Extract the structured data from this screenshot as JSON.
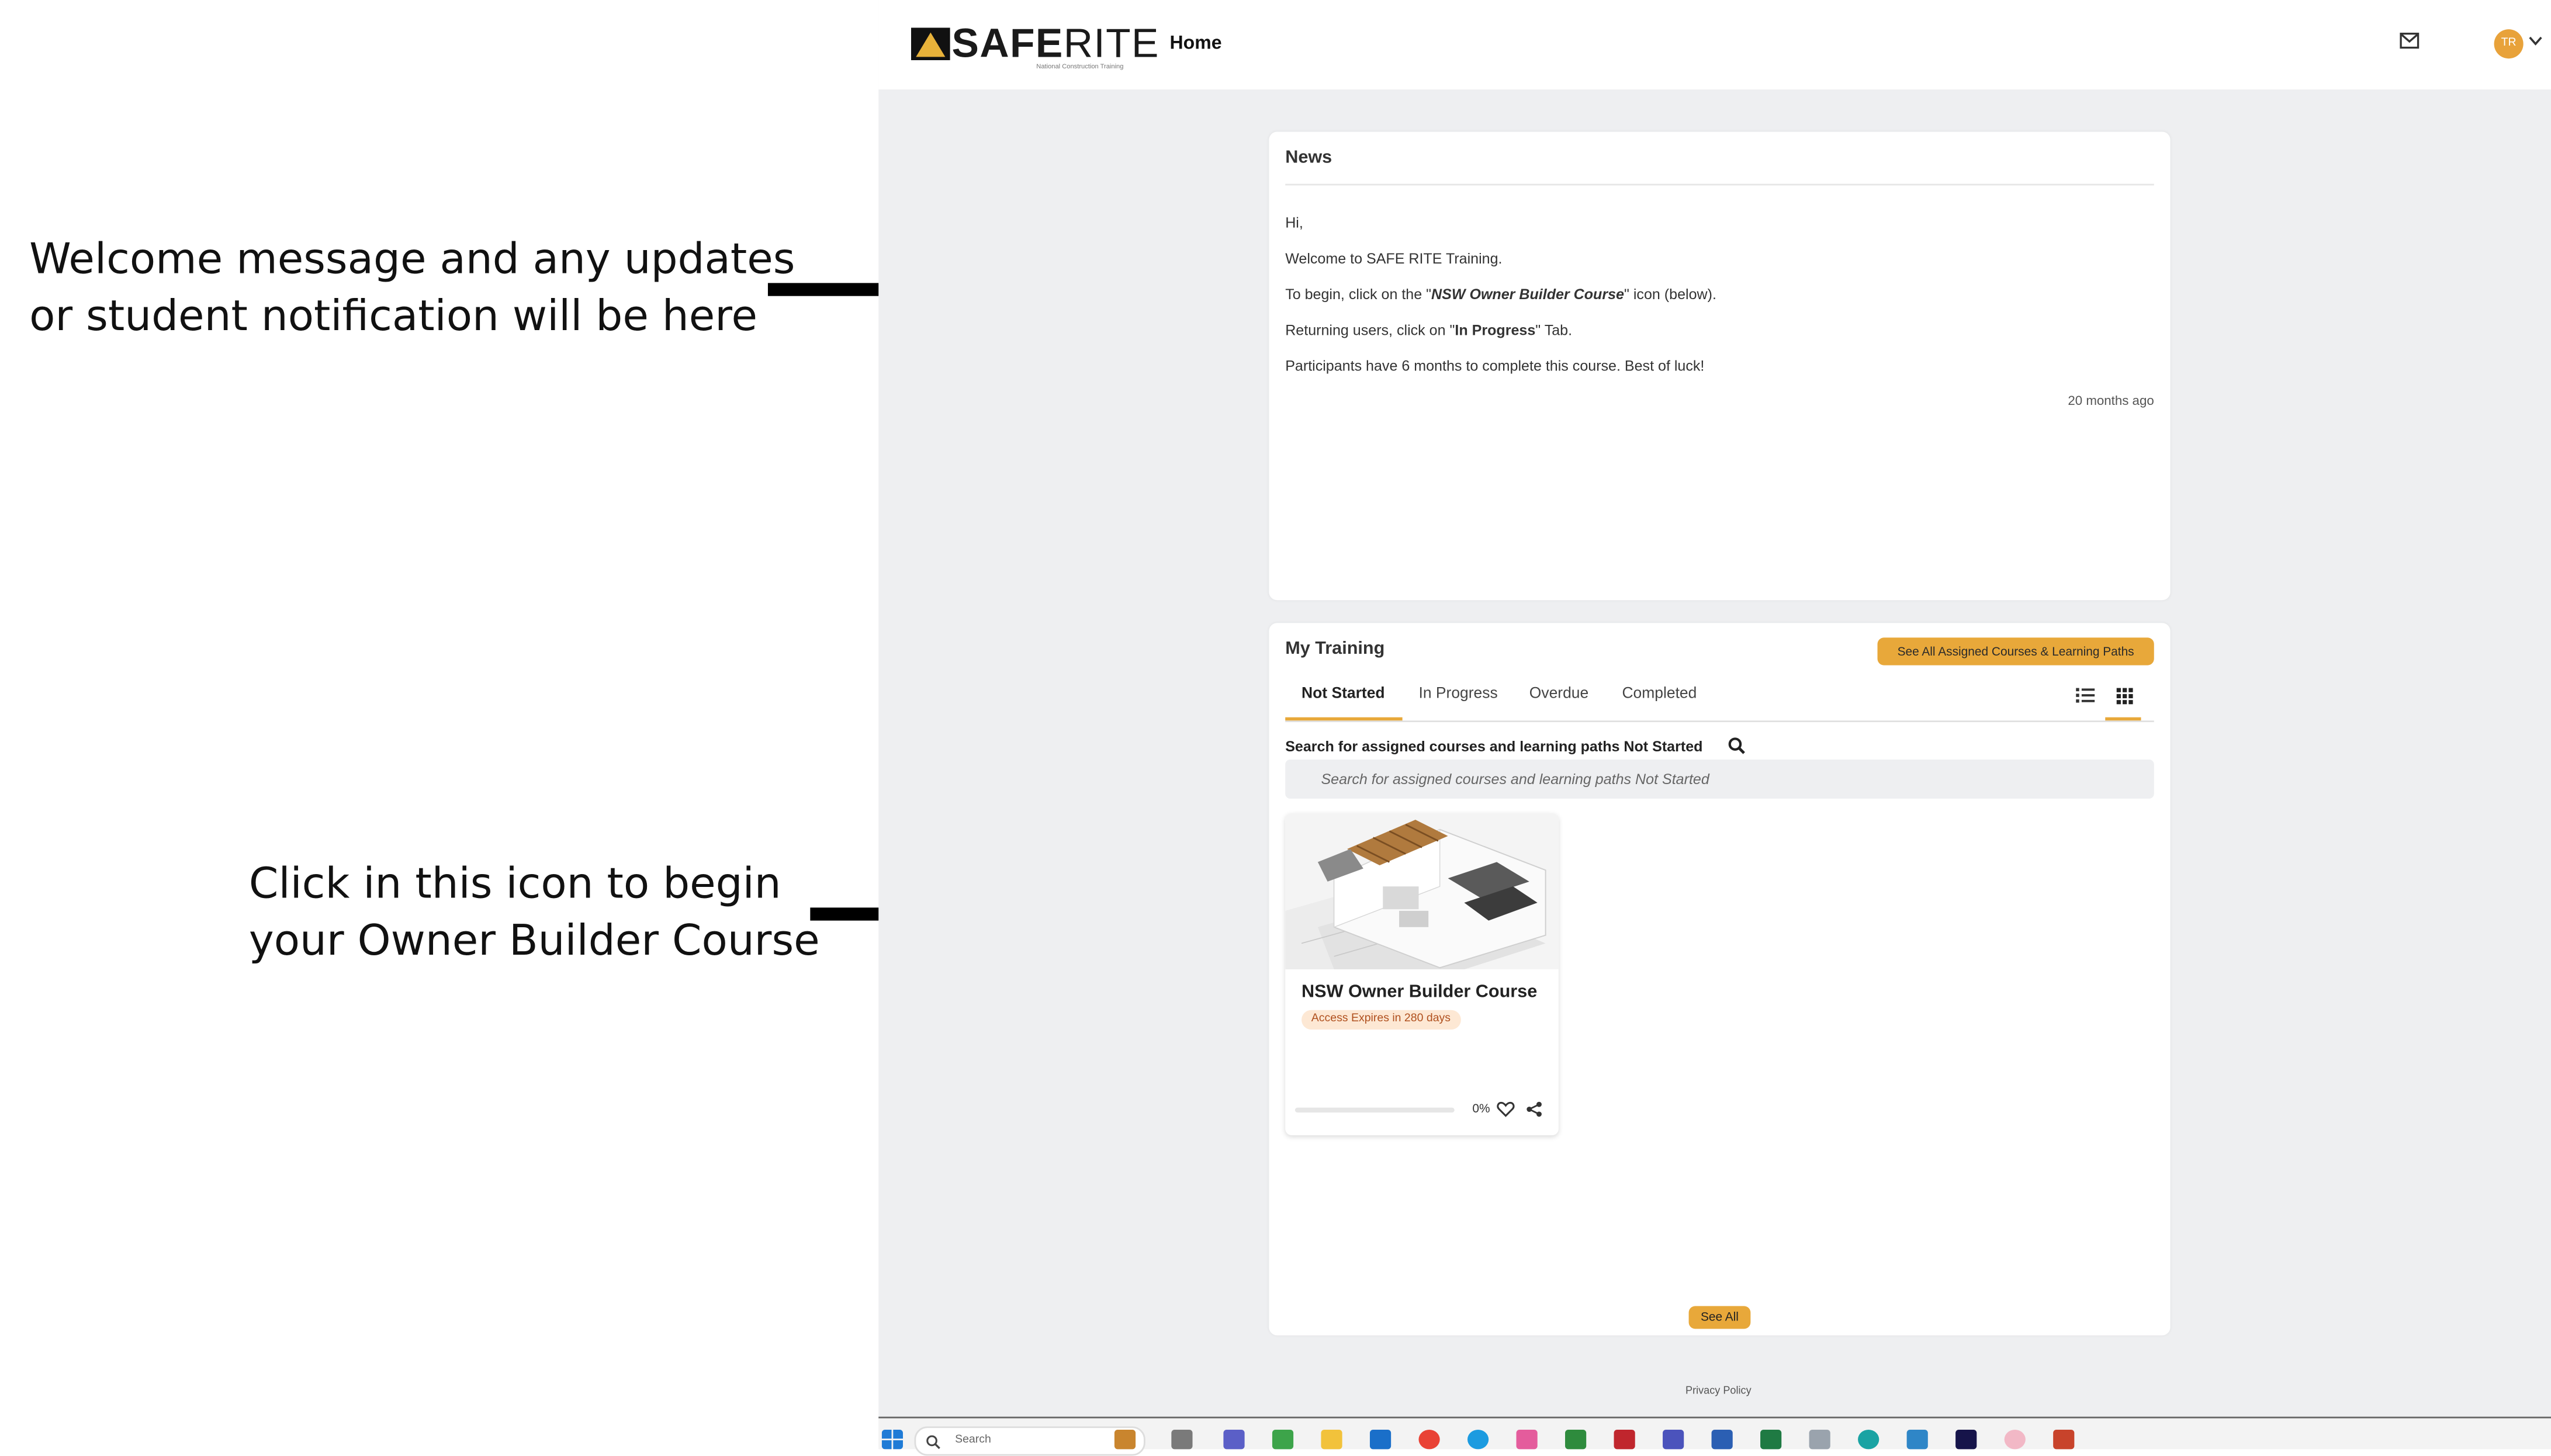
{
  "annotations": {
    "welcome_lines": [
      "Welcome message and any updates",
      "or student notification will be here"
    ],
    "click_lines": [
      "Click in this icon to begin",
      "your Owner Builder Course"
    ]
  },
  "header": {
    "logo_text_bold": "SAFE",
    "logo_text_rest": "RITE",
    "logo_subtitle": "National Construction Training",
    "home_label": "Home",
    "avatar_initials": "TR"
  },
  "news": {
    "title": "News",
    "greeting": "Hi,",
    "welcome": "Welcome to SAFE RITE Training.",
    "begin_prefix": "To begin, click on the \"",
    "begin_course": "NSW Owner Builder Course",
    "begin_suffix": "\" icon (below).",
    "returning_prefix": "Returning users, click on \"",
    "returning_tab": "In Progress",
    "returning_suffix": "\" Tab.",
    "participants": "Participants have 6 months to complete this course. Best of luck!",
    "time_ago": "20 months ago"
  },
  "training": {
    "title": "My Training",
    "see_all_assigned": "See All Assigned Courses & Learning Paths",
    "tabs": [
      "Not Started",
      "In Progress",
      "Overdue",
      "Completed"
    ],
    "search_label": "Search for assigned courses and learning paths Not Started",
    "search_placeholder": "Search for assigned courses and learning paths Not Started",
    "course": {
      "title": "NSW Owner Builder Course",
      "badge": "Access Expires in 280 days",
      "progress_percent": 0,
      "progress_label": "0%"
    },
    "see_all": "See All"
  },
  "footer": {
    "privacy": "Privacy Policy"
  },
  "taskbar": {
    "search_placeholder": "Search"
  },
  "colors": {
    "accent": "#e8a83a",
    "page_bg": "#eeeff1",
    "badge_bg": "#fde8d4",
    "badge_text": "#b0501e"
  }
}
